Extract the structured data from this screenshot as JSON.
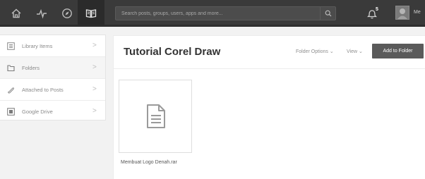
{
  "topbar": {
    "nav": [
      {
        "icon": "home-icon"
      },
      {
        "icon": "activity-icon"
      },
      {
        "icon": "compass-icon"
      },
      {
        "icon": "book-icon",
        "active": true
      }
    ],
    "search": {
      "placeholder": "Search posts, groups, users, apps and more...",
      "value": ""
    },
    "notifications": {
      "count": "5",
      "icon": "bell-icon"
    },
    "user_label": "Me"
  },
  "sidebar": {
    "items": [
      {
        "label": "Library Items",
        "icon": "library-icon"
      },
      {
        "label": "Folders",
        "icon": "folder-icon",
        "active": true
      },
      {
        "label": "Attached to Posts",
        "icon": "paperclip-icon"
      },
      {
        "label": "Google Drive",
        "icon": "drive-icon"
      }
    ]
  },
  "main": {
    "title": "Tutorial Corel Draw",
    "folder_options": "Folder Options",
    "view": "View",
    "add_button": "Add to Folder",
    "files": [
      {
        "name": "Membuat Logo Denah.rar",
        "icon": "document-icon"
      }
    ]
  },
  "colors": {
    "topbar": "#3a3a3a",
    "button": "#5a5a5a",
    "background": "#f2f2f2"
  }
}
